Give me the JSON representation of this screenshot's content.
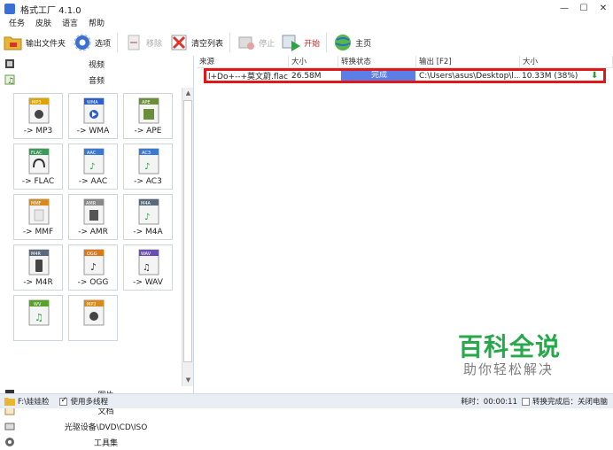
{
  "window": {
    "title": "格式工厂 4.1.0"
  },
  "menu": [
    "任务",
    "皮肤",
    "语言",
    "帮助"
  ],
  "toolbar": {
    "output_folder": "输出文件夹",
    "options": "选项",
    "remove": "移除",
    "clear_list": "清空列表",
    "stop": "停止",
    "start": "开始",
    "home": "主页"
  },
  "sidebar": {
    "video": "视频",
    "audio": "音频",
    "tiles": [
      {
        "label": "-> MP3",
        "badge": "MP3",
        "color": "#e0a400"
      },
      {
        "label": "-> WMA",
        "badge": "WMA",
        "color": "#2b5fcf"
      },
      {
        "label": "-> APE",
        "badge": "APE",
        "color": "#6b8e3a"
      },
      {
        "label": "-> FLAC",
        "badge": "FLAC",
        "color": "#3d9a5a"
      },
      {
        "label": "-> AAC",
        "badge": "AAC",
        "color": "#3b78d0"
      },
      {
        "label": "-> AC3",
        "badge": "AC3",
        "color": "#3b78d0"
      },
      {
        "label": "-> MMF",
        "badge": "MMF",
        "color": "#d88a1a"
      },
      {
        "label": "-> AMR",
        "badge": "AMR",
        "color": "#888888"
      },
      {
        "label": "-> M4A",
        "badge": "M4A",
        "color": "#5b6a7a"
      },
      {
        "label": "-> M4R",
        "badge": "M4R",
        "color": "#5b6a7a"
      },
      {
        "label": "-> OGG",
        "badge": "OGG",
        "color": "#d87a1a"
      },
      {
        "label": "-> WAV",
        "badge": "WAV",
        "color": "#6a4fb0"
      },
      {
        "label": "",
        "badge": "WV",
        "color": "#5aa02c"
      },
      {
        "label": "",
        "badge": "MP2",
        "color": "#d88a1a"
      }
    ],
    "picture": "图片",
    "document": "文档",
    "optical": "光驱设备\\DVD\\CD\\ISO",
    "toolbox": "工具集"
  },
  "table": {
    "columns": [
      "来源",
      "大小",
      "转换状态",
      "输出 [F2]",
      "大小"
    ],
    "rows": [
      {
        "source": "l+Do+--+莫文蔚.flac",
        "size": "26.58M",
        "status": "完成",
        "output": "C:\\Users\\asus\\Desktop\\l...",
        "out_size": "10.33M  (38%)"
      }
    ]
  },
  "watermark": {
    "line1": "百科全说",
    "line2": "助你轻松解决"
  },
  "status": {
    "path": "F:\\娃娃脸",
    "multithread": "使用多线程",
    "elapsed": "耗时：00:00:11",
    "after_convert": "转换完成后：关闭电脑"
  }
}
